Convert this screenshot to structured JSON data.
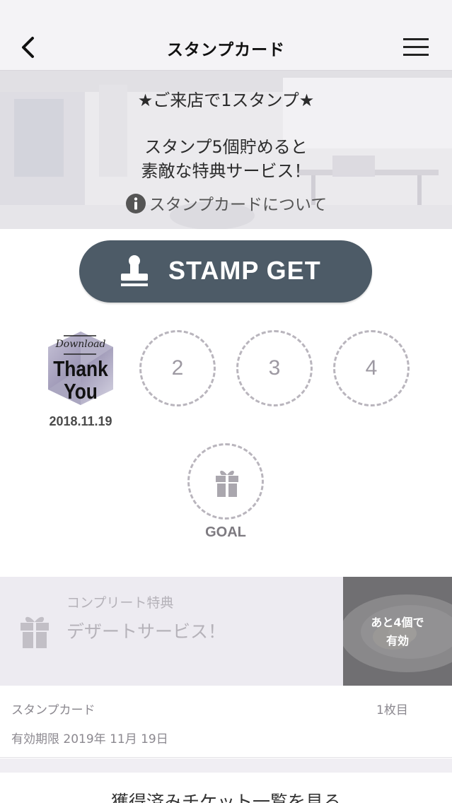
{
  "header": {
    "title": "スタンプカード",
    "back_icon": "chevron-left-icon",
    "menu_icon": "hamburger-menu-icon"
  },
  "hero": {
    "line1": "★ご来店で1スタンプ★",
    "line2": "スタンプ5個貯めると",
    "line3": "素敵な特典サービス！",
    "info_link": "スタンプカードについて",
    "info_icon": "info-icon"
  },
  "stamp_button": {
    "label": "STAMP GET",
    "icon": "stamp-icon"
  },
  "stamps": {
    "first": {
      "badge_top": "Download",
      "badge_line1": "Thank",
      "badge_line2": "You",
      "date": "2018.11.19"
    },
    "slot2": "2",
    "slot3": "3",
    "slot4": "4",
    "goal_label": "GOAL",
    "goal_icon": "gift-icon"
  },
  "complete": {
    "title": "コンプリート特典",
    "reward": "デザートサービス！",
    "remain_line1": "あと4個で",
    "remain_line2": "有効"
  },
  "card_info": {
    "label": "スタンプカード",
    "count": "1枚目",
    "expiry": "有効期限 2019年 11月 19日"
  },
  "ticket_link": "獲得済みチケット一覧を見る",
  "colors": {
    "button": "#4d5b67",
    "nav_bg": "#f4f3f6",
    "slot_border": "#b9b5bd",
    "complete_bg": "#edebf1"
  }
}
